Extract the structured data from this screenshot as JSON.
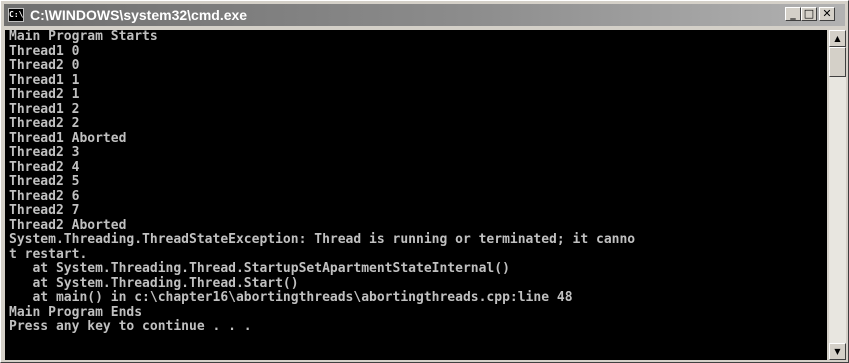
{
  "window": {
    "title": "C:\\WINDOWS\\system32\\cmd.exe",
    "icon_label": "C:\\",
    "buttons": {
      "minimize": "_",
      "maximize": "□",
      "close": "✕"
    }
  },
  "console": {
    "lines": [
      "Main Program Starts",
      "Thread1 0",
      "Thread2 0",
      "Thread1 1",
      "Thread2 1",
      "Thread1 2",
      "Thread2 2",
      "Thread1 Aborted",
      "Thread2 3",
      "Thread2 4",
      "Thread2 5",
      "Thread2 6",
      "Thread2 7",
      "Thread2 Aborted",
      "System.Threading.ThreadStateException: Thread is running or terminated; it canno",
      "t restart.",
      "   at System.Threading.Thread.StartupSetApartmentStateInternal()",
      "   at System.Threading.Thread.Start()",
      "   at main() in c:\\chapter16\\abortingthreads\\abortingthreads.cpp:line 48",
      "Main Program Ends",
      "Press any key to continue . . ."
    ]
  },
  "scrollbar": {
    "up_arrow": "▲",
    "down_arrow": "▼"
  },
  "colors": {
    "console_bg": "#000000",
    "console_text": "#c0c0c0",
    "titlebar": "#7a7a7a",
    "chrome": "#d4d0c8"
  }
}
